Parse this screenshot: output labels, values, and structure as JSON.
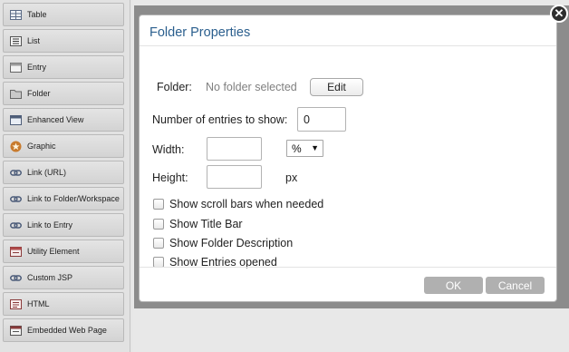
{
  "palette": {
    "items": [
      {
        "label": "Table",
        "icon": "table-icon"
      },
      {
        "label": "List",
        "icon": "list-icon"
      },
      {
        "label": "Entry",
        "icon": "entry-icon"
      },
      {
        "label": "Folder",
        "icon": "folder-icon"
      },
      {
        "label": "Enhanced View",
        "icon": "enhanced-view-icon"
      },
      {
        "label": "Graphic",
        "icon": "graphic-icon"
      },
      {
        "label": "Link (URL)",
        "icon": "link-icon"
      },
      {
        "label": "Link to Folder/Workspace",
        "icon": "link-icon"
      },
      {
        "label": "Link to Entry",
        "icon": "link-icon"
      },
      {
        "label": "Utility Element",
        "icon": "utility-icon"
      },
      {
        "label": "Custom JSP",
        "icon": "link-icon"
      },
      {
        "label": "HTML",
        "icon": "html-icon"
      },
      {
        "label": "Embedded Web Page",
        "icon": "web-page-icon"
      }
    ]
  },
  "modal": {
    "title": "Folder Properties",
    "folder_label": "Folder:",
    "folder_value": "No folder selected",
    "edit_label": "Edit",
    "entries_label": "Number of entries to show:",
    "entries_value": "0",
    "width_label": "Width:",
    "width_value": "",
    "width_unit": "%",
    "height_label": "Height:",
    "height_value": "",
    "height_unit": "px",
    "checkboxes": [
      {
        "label": "Show scroll bars when needed",
        "checked": false
      },
      {
        "label": "Show Title Bar",
        "checked": false
      },
      {
        "label": "Show Folder Description",
        "checked": false
      },
      {
        "label": "Show Entries opened",
        "checked": false
      }
    ],
    "ok_label": "OK",
    "cancel_label": "Cancel",
    "close_symbol": "✕"
  },
  "colors": {
    "title": "#2b5f8e",
    "overlay": "#8c8c8c",
    "footer_button": "#b0b0b0"
  }
}
